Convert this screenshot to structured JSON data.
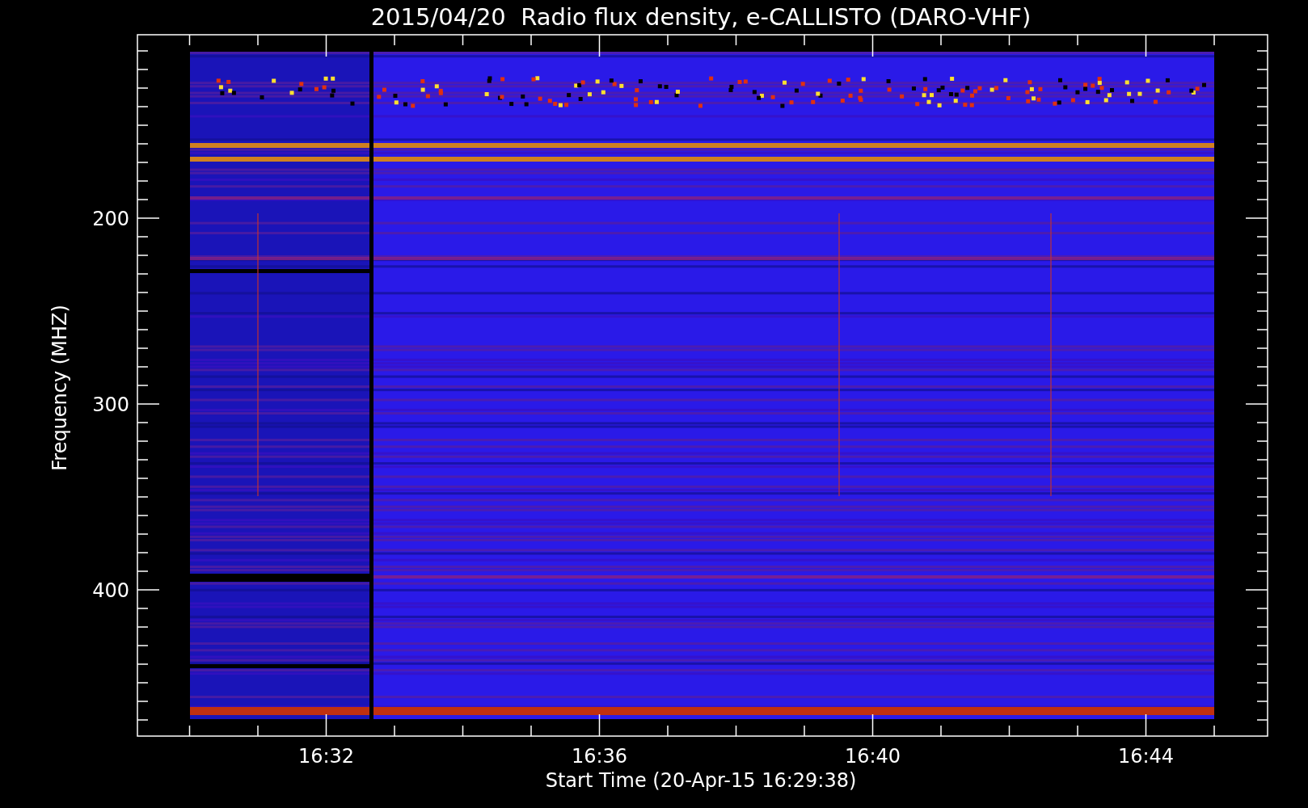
{
  "plot": {
    "title": "2015/04/20  Radio flux density, e-CALLISTO (DARO-VHF)",
    "y_axis": {
      "label": "Frequency (MHZ)",
      "tick_labels": [
        "200",
        "300",
        "400"
      ]
    },
    "x_axis": {
      "label": "Start Time (20-Apr-15 16:29:38)",
      "tick_labels": [
        "16:32",
        "16:36",
        "16:40",
        "16:44"
      ]
    }
  }
}
